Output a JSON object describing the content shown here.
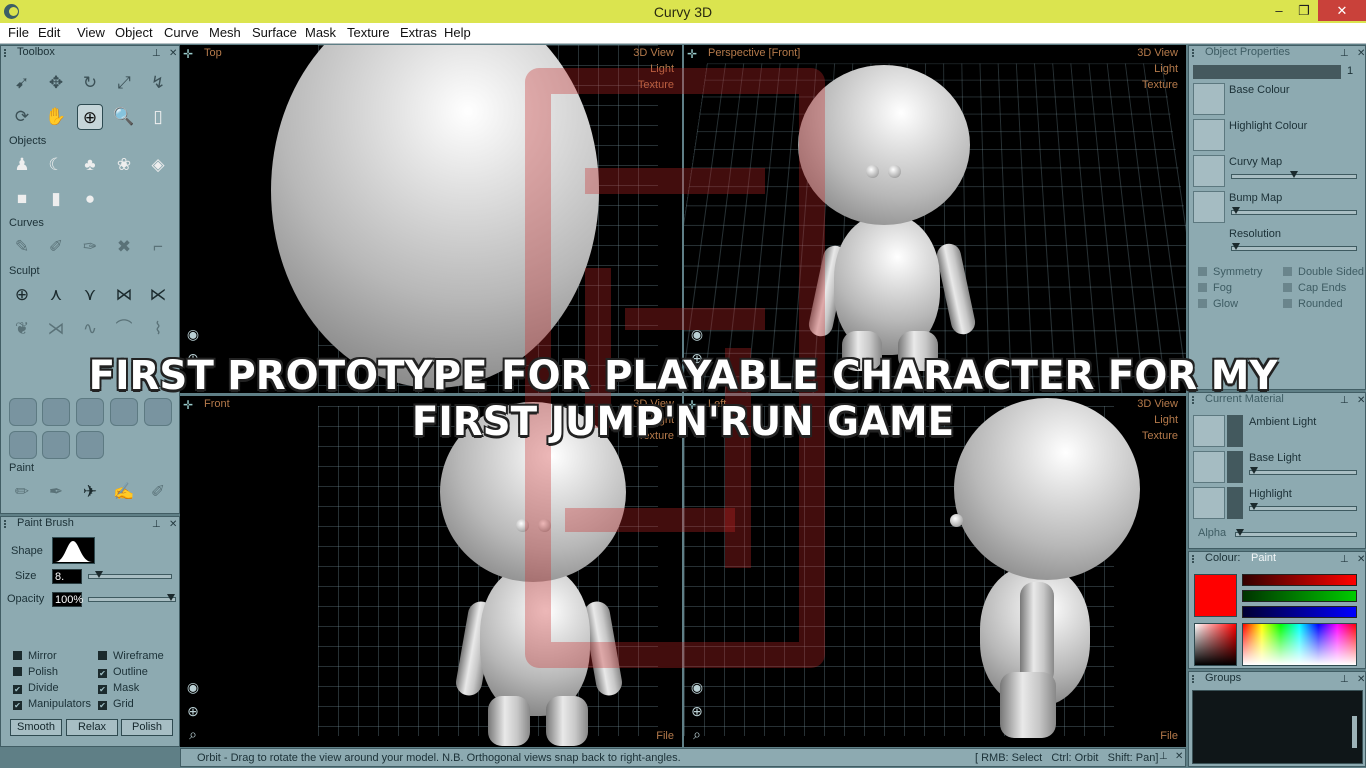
{
  "window": {
    "title": "Curvy 3D",
    "minimize": "–",
    "maximize": "❐",
    "close": "✕"
  },
  "menu": [
    "File",
    "Edit",
    "View",
    "Object",
    "Curve",
    "Mesh",
    "Surface",
    "Mask",
    "Texture",
    "Extras",
    "Help"
  ],
  "toolbox": {
    "title": "Toolbox",
    "sections": {
      "objects": "Objects",
      "curves": "Curves",
      "sculpt": "Sculpt",
      "paint": "Paint"
    },
    "view_tools": [
      "select-arrow-icon",
      "move-icon",
      "rotate-icon",
      "scale-icon",
      "pivot-icon",
      "orbit-icon",
      "hand-pan-icon",
      "target-icon",
      "zoom-icon",
      "card-icon"
    ],
    "object_tools": [
      "character-icon",
      "moon-icon",
      "tree-icon",
      "blob-icon",
      "sheet-icon",
      "cube-icon",
      "cylinder-icon",
      "sphere-icon"
    ],
    "curve_tools": [
      "curve-pen-icon",
      "curve-edit-icon",
      "curve-smooth-icon",
      "curve-cross-icon",
      "curve-corner-icon"
    ],
    "sculpt_tools": [
      "sculpt-grab-icon",
      "sculpt-pull-icon",
      "sculpt-push-icon",
      "sculpt-pinch-icon",
      "sculpt-inflate-icon",
      "sculpt-smudge-icon",
      "sculpt-flatten-icon",
      "sculpt-wave-icon",
      "sculpt-arch-icon",
      "sculpt-zigzag-icon"
    ],
    "paint_tools": [
      "brush-icon",
      "smudge-brush-icon",
      "spray-icon",
      "blur-brush-icon",
      "eraser-brush-icon"
    ]
  },
  "paint_brush": {
    "title": "Paint Brush",
    "shape_label": "Shape",
    "size_label": "Size",
    "size_value": "8.",
    "size_fraction": 0.08,
    "opacity_label": "Opacity",
    "opacity_value": "100%",
    "opacity_fraction": 1.0,
    "checkboxes": [
      {
        "label": "Mirror",
        "checked": false
      },
      {
        "label": "Wireframe",
        "checked": false
      },
      {
        "label": "Polish",
        "checked": false
      },
      {
        "label": "Outline",
        "checked": true
      },
      {
        "label": "Divide",
        "checked": true
      },
      {
        "label": "Mask",
        "checked": true
      },
      {
        "label": "Manipulators",
        "checked": true
      },
      {
        "label": "Grid",
        "checked": true
      }
    ],
    "buttons": [
      "Smooth",
      "Relax",
      "Polish"
    ]
  },
  "viewports": [
    {
      "title": "Top",
      "links": [
        "3D View",
        "Light",
        "Texture"
      ]
    },
    {
      "title": "Perspective [Front]",
      "links": [
        "3D View",
        "Light",
        "Texture"
      ]
    },
    {
      "title": "Front",
      "links": [
        "3D View",
        "Light",
        "Texture"
      ],
      "footer": "File"
    },
    {
      "title": "Left",
      "links": [
        "3D View",
        "Light",
        "Texture"
      ],
      "footer": "File"
    }
  ],
  "object_properties": {
    "title": "Object Properties",
    "index": "1",
    "maps": [
      {
        "label": "Base Colour",
        "has_slider": false
      },
      {
        "label": "Highlight Colour",
        "has_slider": false
      },
      {
        "label": "Curvy Map",
        "has_slider": true,
        "value": 0.5
      },
      {
        "label": "Bump Map",
        "has_slider": true,
        "value": 0.0
      }
    ],
    "resolution_label": "Resolution",
    "resolution_value": 0.0,
    "options": [
      {
        "label": "Symmetry"
      },
      {
        "label": "Double Sided"
      },
      {
        "label": "Fog"
      },
      {
        "label": "Cap Ends"
      },
      {
        "label": "Glow"
      },
      {
        "label": "Rounded"
      }
    ]
  },
  "current_material": {
    "title": "Current Material",
    "rows": [
      {
        "label": "Ambient Light",
        "has_slider": false
      },
      {
        "label": "Base Light",
        "has_slider": true,
        "value": 0.0
      },
      {
        "label": "Highlight",
        "has_slider": true,
        "value": 0.0
      }
    ],
    "alpha_label": "Alpha",
    "alpha_value": 0.0
  },
  "colour": {
    "title": "Colour:",
    "mode": "Paint",
    "current": "#ff0000"
  },
  "groups": {
    "title": "Groups"
  },
  "caption": "FIRST PROTOTYPE FOR PLAYABLE CHARACTER FOR MY FIRST JUMP'N'RUN GAME",
  "status": {
    "message": "Orbit - Drag to rotate the view around your model. N.B. Orthogonal views snap back to right-angles.",
    "hints": "[ RMB: Select   Ctrl: Orbit   Shift: Pan]"
  }
}
